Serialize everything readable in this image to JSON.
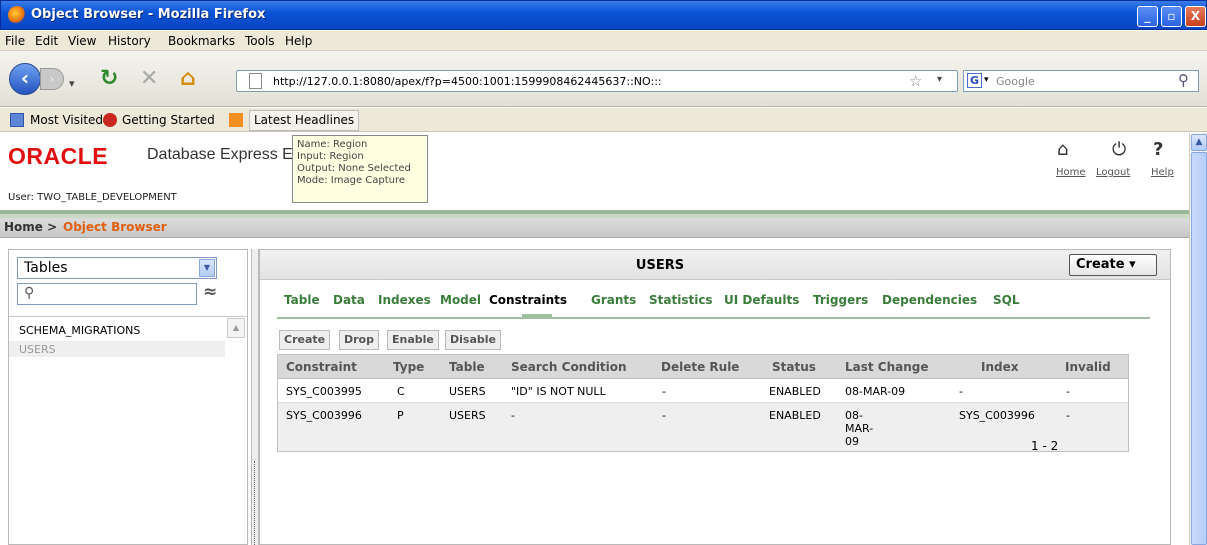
{
  "window": {
    "title": "Object Browser - Mozilla Firefox",
    "min": "_",
    "max": "▫",
    "close": "X"
  },
  "menu": [
    "File",
    "Edit",
    "View",
    "History",
    "Bookmarks",
    "Tools",
    "Help"
  ],
  "nav": {
    "url": "http://127.0.0.1:8080/apex/f?p=4500:1001:1599908462445637::NO:::",
    "search_placeholder": "Google"
  },
  "bookmarks": [
    "Most Visited",
    "Getting Started",
    "Latest Headlines"
  ],
  "app": {
    "brand": "ORACLE",
    "product": "Database Express Edition",
    "user": "User: TWO_TABLE_DEVELOPMENT",
    "links": {
      "home": "Home",
      "logout": "Logout",
      "help": "Help"
    },
    "tooltip": [
      "Name: Region",
      "Input: Region",
      "Output: None Selected",
      "Mode: Image Capture"
    ],
    "breadcrumb": {
      "home": "Home >",
      "current": "Object Browser"
    }
  },
  "left": {
    "select": "Tables",
    "items": [
      "SCHEMA_MIGRATIONS",
      "USERS"
    ]
  },
  "right": {
    "title": "USERS",
    "create": "Create",
    "tabs": [
      "Table",
      "Data",
      "Indexes",
      "Model",
      "Constraints",
      "Grants",
      "Statistics",
      "UI Defaults",
      "Triggers",
      "Dependencies",
      "SQL"
    ],
    "actions": [
      "Create",
      "Drop",
      "Enable",
      "Disable"
    ],
    "columns": [
      "Constraint",
      "Type",
      "Table",
      "Search Condition",
      "Delete Rule",
      "Status",
      "Last Change",
      "Index",
      "Invalid"
    ],
    "rows": [
      [
        "SYS_C003995",
        "C",
        "USERS",
        "\"ID\" IS NOT NULL",
        "-",
        "ENABLED",
        "08-MAR-09",
        "-",
        "-"
      ],
      [
        "SYS_C003996",
        "P",
        "USERS",
        "-",
        "-",
        "ENABLED",
        "08-MAR-09",
        "SYS_C003996",
        "-"
      ]
    ],
    "pager": "1 - 2"
  }
}
